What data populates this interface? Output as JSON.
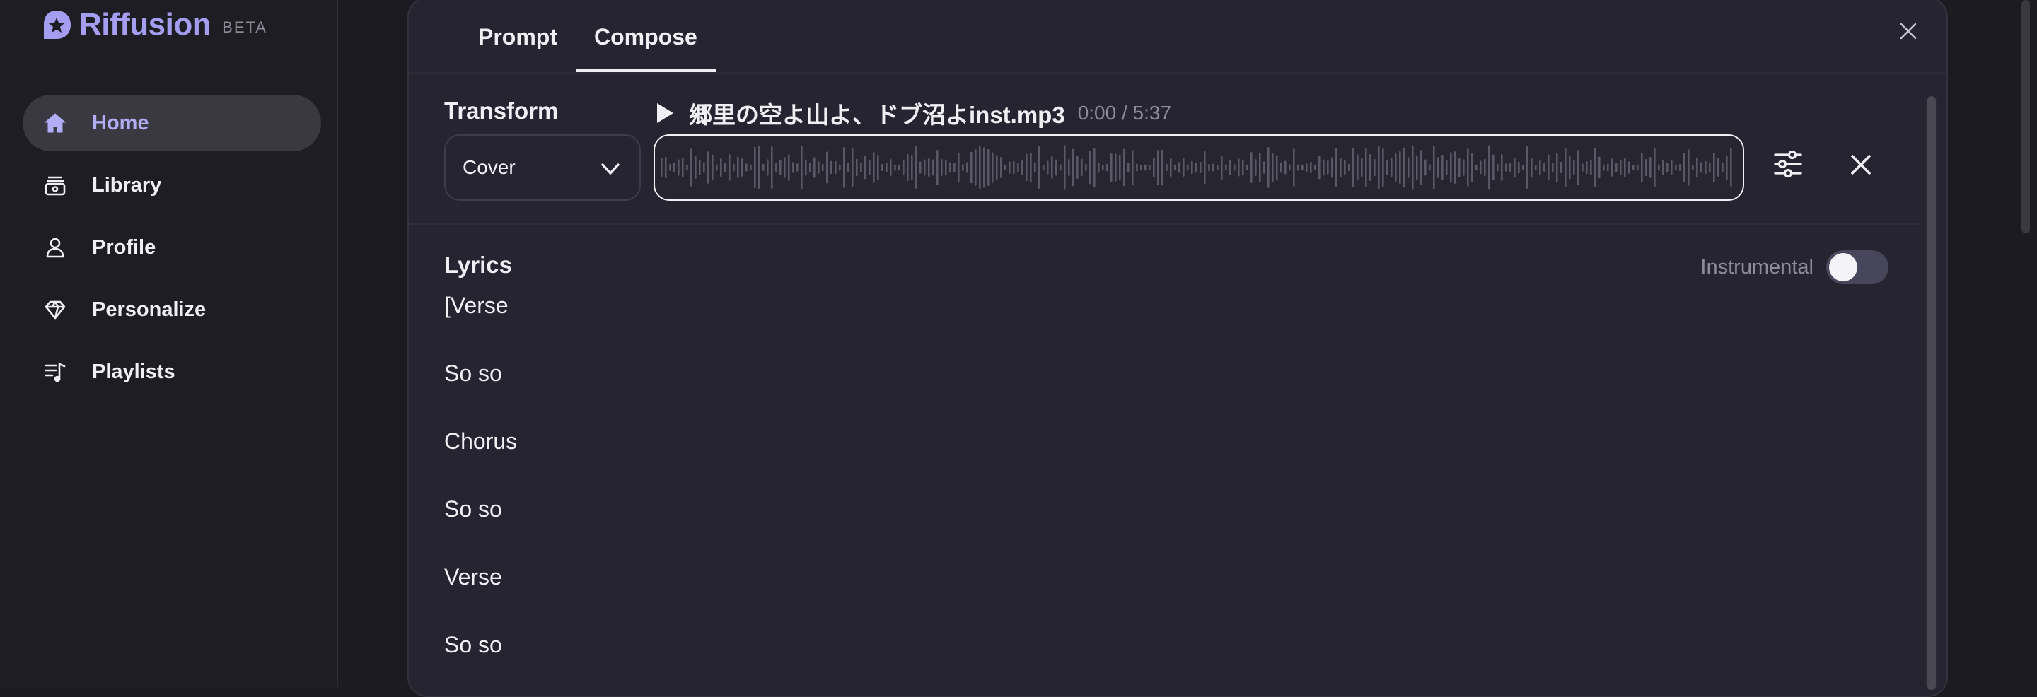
{
  "sidebar": {
    "logo_text": "Riffusion",
    "badge": "BETA",
    "items": [
      {
        "label": "Home",
        "icon": "home-icon",
        "active": true
      },
      {
        "label": "Library",
        "icon": "library-icon"
      },
      {
        "label": "Profile",
        "icon": "profile-icon"
      },
      {
        "label": "Personalize",
        "icon": "gem-icon"
      },
      {
        "label": "Playlists",
        "icon": "playlist-icon"
      }
    ]
  },
  "modal": {
    "tabs": [
      {
        "label": "Prompt",
        "active": false
      },
      {
        "label": "Compose",
        "active": true
      }
    ],
    "transform": {
      "label": "Transform",
      "selected": "Cover"
    },
    "track": {
      "name": "郷里の空よ山よ、ドブ沼よinst.mp3",
      "time": "0:00 / 5:37"
    },
    "lyrics": {
      "label": "Lyrics",
      "instrumental_label": "Instrumental",
      "instrumental_on": false,
      "lines": [
        "[Verse",
        "So so",
        "Chorus",
        "So so",
        "Verse",
        "So so"
      ]
    }
  },
  "colors": {
    "accent": "#a59ef0",
    "background": "#1c1b21",
    "modal_bg": "#252430"
  }
}
